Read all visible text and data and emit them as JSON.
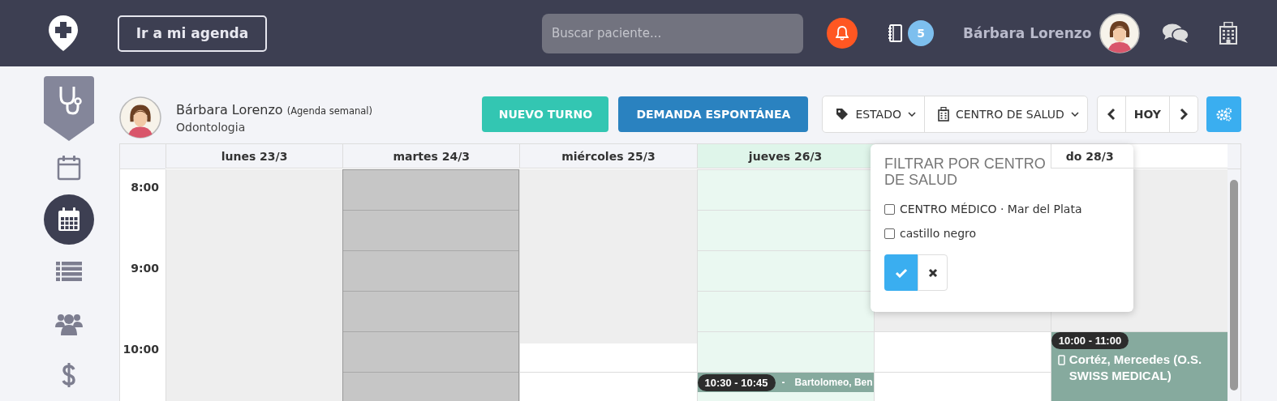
{
  "topbar": {
    "agenda_button": "Ir a mi agenda",
    "search": {
      "placeholder": "Buscar paciente..."
    },
    "notebook_badge": "5",
    "user_name": "Bárbara Lorenzo"
  },
  "sidebar": {
    "items": [
      {
        "kind": "calendar",
        "selected": false
      },
      {
        "kind": "calendar-grid",
        "selected": true
      },
      {
        "kind": "list",
        "selected": false
      },
      {
        "kind": "users",
        "selected": false
      },
      {
        "kind": "dollar",
        "selected": false
      }
    ]
  },
  "professional": {
    "name": "Bárbara Lorenzo",
    "view": "(Agenda semanal)",
    "specialty": "Odontologia"
  },
  "actions": [
    {
      "label": "NUEVO TURNO",
      "kind": "teal"
    },
    {
      "label": "DEMANDA ESPONTÁNEA",
      "kind": "blue"
    }
  ],
  "filters": [
    {
      "label": "ESTADO",
      "kind": "tag"
    },
    {
      "label": "CENTRO DE SALUD",
      "kind": "building"
    }
  ],
  "nav": {
    "today": "HOY"
  },
  "calendar": {
    "hours": [
      "8:00",
      "9:00",
      "10:00"
    ],
    "days": [
      {
        "label": "lunes 23/3",
        "today": false,
        "slots": [
          {
            "kind": "off"
          },
          {
            "kind": "off"
          },
          {
            "kind": "off"
          },
          {
            "kind": "off"
          },
          {
            "kind": "off"
          },
          {
            "kind": "off"
          }
        ]
      },
      {
        "label": "martes 24/3",
        "today": false,
        "slots": [
          {
            "kind": "blocked"
          },
          {
            "kind": "blocked"
          },
          {
            "kind": "blocked"
          },
          {
            "kind": "blocked"
          },
          {
            "kind": "blocked"
          },
          {
            "kind": "blocked"
          }
        ]
      },
      {
        "label": "miércoles 25/3",
        "today": false,
        "slots": [
          {
            "kind": "off"
          },
          {
            "kind": "off"
          },
          {
            "kind": "off"
          },
          {
            "kind": "off"
          },
          {
            "kind": "partial"
          },
          {
            "kind": "free"
          }
        ]
      },
      {
        "label": "jueves 26/3",
        "today": true,
        "slots": [
          {
            "kind": "free"
          },
          {
            "kind": "free"
          },
          {
            "kind": "free"
          },
          {
            "kind": "free"
          },
          {
            "kind": "free"
          },
          {
            "kind": "free",
            "event": {
              "time": "10:30 - 10:45",
              "separator": "-",
              "patient": "Bartolomeo, Ben",
              "kind": "quarter"
            }
          }
        ]
      },
      {
        "slots": [
          {
            "kind": "off"
          },
          {
            "kind": "free"
          },
          {
            "kind": "free"
          }
        ]
      },
      {
        "label": "do 28/3",
        "today": false,
        "slots": [
          {
            "kind": "off"
          },
          {
            "kind": "off"
          },
          {
            "kind": "off"
          },
          {
            "kind": "off"
          },
          {
            "kind": "free",
            "event": {
              "time": "10:00 - 11:00",
              "patient": "Cortéz, Mercedes (O.S. SWISS MEDICAL)",
              "kind": "hour",
              "phone": true
            }
          }
        ]
      }
    ]
  },
  "popup": {
    "title": "FILTRAR POR CENTRO DE SALUD",
    "options": [
      {
        "label": "CENTRO MÉDICO · Mar del Plata",
        "checked": false
      },
      {
        "label": "castillo negro",
        "checked": false
      }
    ]
  }
}
